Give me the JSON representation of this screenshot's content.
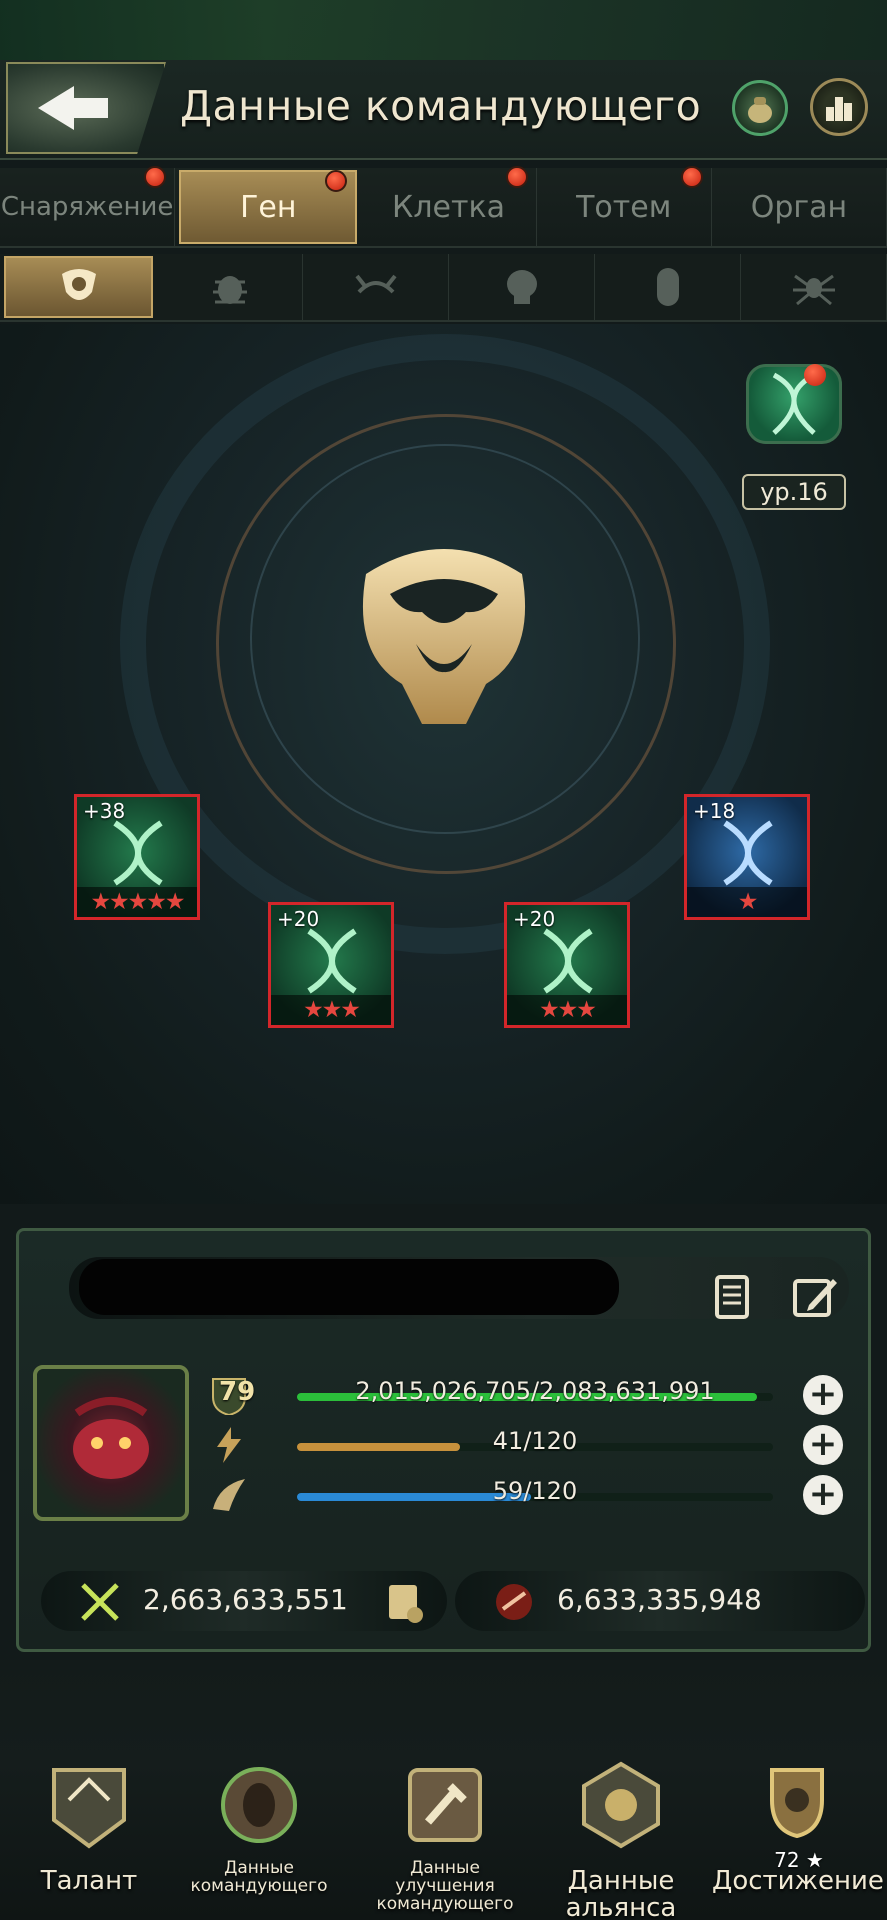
{
  "header": {
    "title": "Данные командующего",
    "back_icon": "back-arrow-icon",
    "bag_icon": "bag-icon",
    "rank_icon": "ranking-icon"
  },
  "tabs": [
    {
      "label": "Снаряжение",
      "active": false,
      "alert": true
    },
    {
      "label": "Ген",
      "active": true,
      "alert": true
    },
    {
      "label": "Клетка",
      "active": false,
      "alert": true
    },
    {
      "label": "Тотем",
      "active": false,
      "alert": true
    },
    {
      "label": "Орган",
      "active": false,
      "alert": false
    }
  ],
  "subtabs": [
    {
      "icon": "bull-emblem-icon",
      "active": true
    },
    {
      "icon": "beetle-icon",
      "active": false
    },
    {
      "icon": "crab-icon",
      "active": false
    },
    {
      "icon": "skull-icon",
      "active": false
    },
    {
      "icon": "capsule-icon",
      "active": false
    },
    {
      "icon": "spider-icon",
      "active": false
    }
  ],
  "gene": {
    "level": "ур.16",
    "cards": [
      {
        "bonus": "+38",
        "stars": 5,
        "type": "green"
      },
      {
        "bonus": "+20",
        "stars": 3,
        "type": "green"
      },
      {
        "bonus": "+20",
        "stars": 3,
        "type": "green"
      },
      {
        "bonus": "+18",
        "stars": 1,
        "type": "blue"
      }
    ]
  },
  "commander": {
    "level": "79",
    "hp": {
      "text": "2,015,026,705/2,083,631,991",
      "fraction": 0.967
    },
    "energy": {
      "text": "41/120",
      "fraction": 0.342
    },
    "stamina": {
      "text": "59/120",
      "fraction": 0.492
    },
    "power": "2,663,633,551",
    "kills": "6,633,335,948"
  },
  "bottom_nav": [
    {
      "label": "Талант",
      "icon": "talent-icon"
    },
    {
      "label": "Данные командующего",
      "icon": "commander-data-icon"
    },
    {
      "label": "Данные улучшения командующего",
      "icon": "upgrade-data-icon"
    },
    {
      "label": "Данные альянса",
      "icon": "alliance-data-icon"
    },
    {
      "label": "Достижение",
      "icon": "achievement-icon",
      "badge": "72 ★"
    }
  ],
  "colors": {
    "accent_gold": "#a78c55",
    "alert_red": "#d3262a",
    "hp_green": "#2bbf3a",
    "energy_orange": "#c7913c",
    "stamina_blue": "#2a8ad6"
  }
}
